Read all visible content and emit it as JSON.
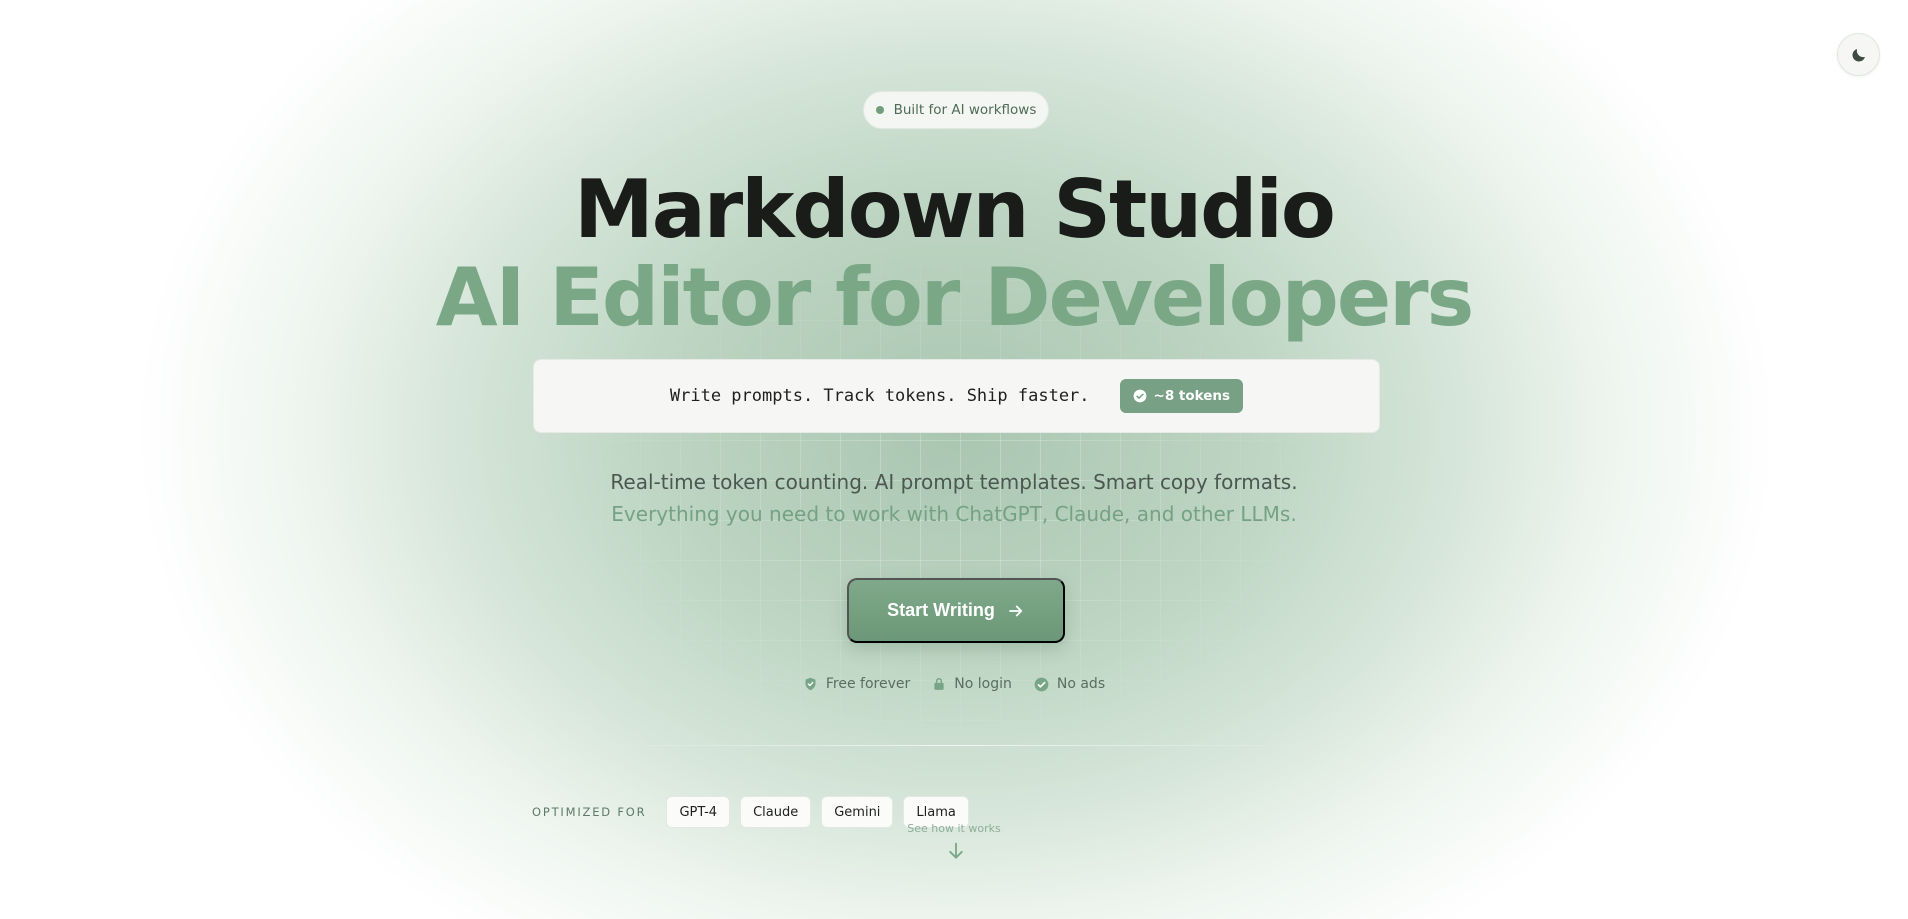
{
  "badge": {
    "text": "Built for AI workflows"
  },
  "hero": {
    "title": "Markdown Studio",
    "subtitle": "AI Editor for Developers"
  },
  "demo": {
    "code_text": "Write prompts. Track tokens. Ship faster.",
    "token_badge": "~8 tokens"
  },
  "taglines": {
    "line1": "Real-time token counting. AI prompt templates. Smart copy formats.",
    "line2": "Everything you need to work with ChatGPT, Claude, and other LLMs."
  },
  "cta": {
    "label": "Start Writing"
  },
  "features": [
    {
      "label": "Free forever",
      "icon": "shield-check-icon"
    },
    {
      "label": "No login",
      "icon": "lock-icon"
    },
    {
      "label": "No ads",
      "icon": "check-circle-icon"
    }
  ],
  "optimized": {
    "label": "OPTIMIZED FOR",
    "models": [
      "GPT-4",
      "Claude",
      "Gemini",
      "Llama"
    ]
  },
  "scroll_hint": {
    "text": "See how it works"
  },
  "colors": {
    "accent": "#7aa887",
    "accent_dark": "#6b9878",
    "title": "#1a1c1a"
  }
}
